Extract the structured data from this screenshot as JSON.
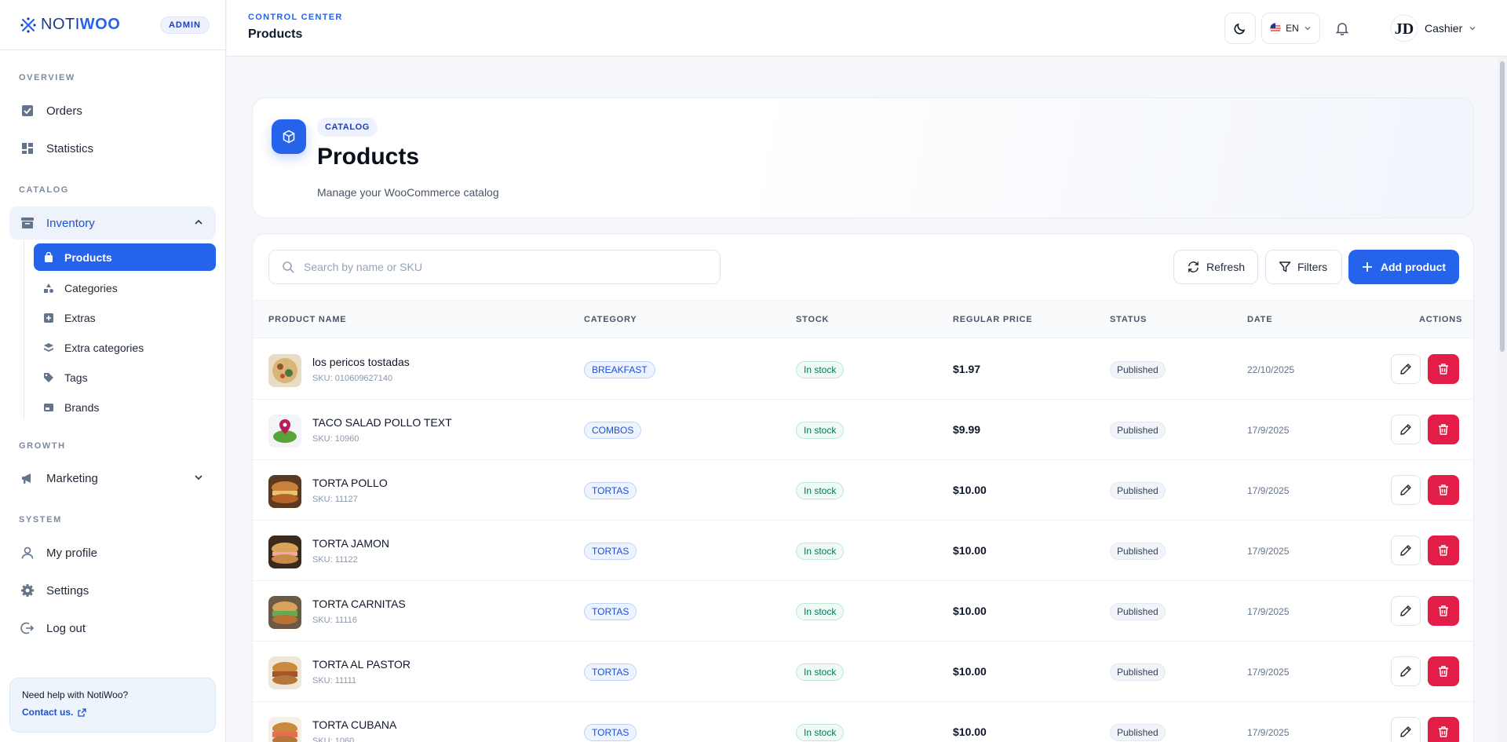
{
  "brand": {
    "name_part1": "NOTI",
    "name_part2": "WOO",
    "role_badge": "ADMIN"
  },
  "sidebar": {
    "sections": {
      "overview": "OVERVIEW",
      "catalog": "CATALOG",
      "growth": "GROWTH",
      "system": "SYSTEM"
    },
    "items": {
      "orders": "Orders",
      "statistics": "Statistics",
      "inventory": "Inventory",
      "marketing": "Marketing",
      "my_profile": "My profile",
      "settings": "Settings",
      "log_out": "Log out"
    },
    "inventory_sub": [
      "Products",
      "Categories",
      "Extras",
      "Extra categories",
      "Tags",
      "Brands"
    ],
    "help": {
      "text": "Need help with NotiWoo?",
      "link": "Contact us."
    }
  },
  "header": {
    "section": "CONTROL CENTER",
    "title": "Products",
    "language": "EN",
    "user_name": "Cashier",
    "avatar_initials": "JD"
  },
  "hero": {
    "tag": "CATALOG",
    "title": "Products",
    "subtitle": "Manage your WooCommerce catalog"
  },
  "toolbar": {
    "search_placeholder": "Search by name or SKU",
    "refresh_label": "Refresh",
    "filters_label": "Filters",
    "add_label": "Add product"
  },
  "table": {
    "columns": [
      "PRODUCT NAME",
      "CATEGORY",
      "STOCK",
      "REGULAR PRICE",
      "STATUS",
      "DATE",
      "ACTIONS"
    ],
    "rows": [
      {
        "name": "los pericos tostadas",
        "sku": "SKU: 010609627140",
        "category": "BREAKFAST",
        "stock": "In stock",
        "price": "$1.97",
        "status": "Published",
        "date": "22/10/2025"
      },
      {
        "name": "TACO SALAD POLLO TEXT",
        "sku": "SKU: 10960",
        "category": "COMBOS",
        "stock": "In stock",
        "price": "$9.99",
        "status": "Published",
        "date": "17/9/2025"
      },
      {
        "name": "TORTA POLLO",
        "sku": "SKU: 11127",
        "category": "TORTAS",
        "stock": "In stock",
        "price": "$10.00",
        "status": "Published",
        "date": "17/9/2025"
      },
      {
        "name": "TORTA JAMON",
        "sku": "SKU: 11122",
        "category": "TORTAS",
        "stock": "In stock",
        "price": "$10.00",
        "status": "Published",
        "date": "17/9/2025"
      },
      {
        "name": "TORTA CARNITAS",
        "sku": "SKU: 11116",
        "category": "TORTAS",
        "stock": "In stock",
        "price": "$10.00",
        "status": "Published",
        "date": "17/9/2025"
      },
      {
        "name": "TORTA AL PASTOR",
        "sku": "SKU: 11111",
        "category": "TORTAS",
        "stock": "In stock",
        "price": "$10.00",
        "status": "Published",
        "date": "17/9/2025"
      },
      {
        "name": "TORTA CUBANA",
        "sku": "SKU: 1060",
        "category": "TORTAS",
        "stock": "In stock",
        "price": "$10.00",
        "status": "Published",
        "date": "17/9/2025"
      }
    ]
  },
  "colors": {
    "accent": "#2563eb",
    "danger": "#e11d48",
    "success": "#047857"
  }
}
